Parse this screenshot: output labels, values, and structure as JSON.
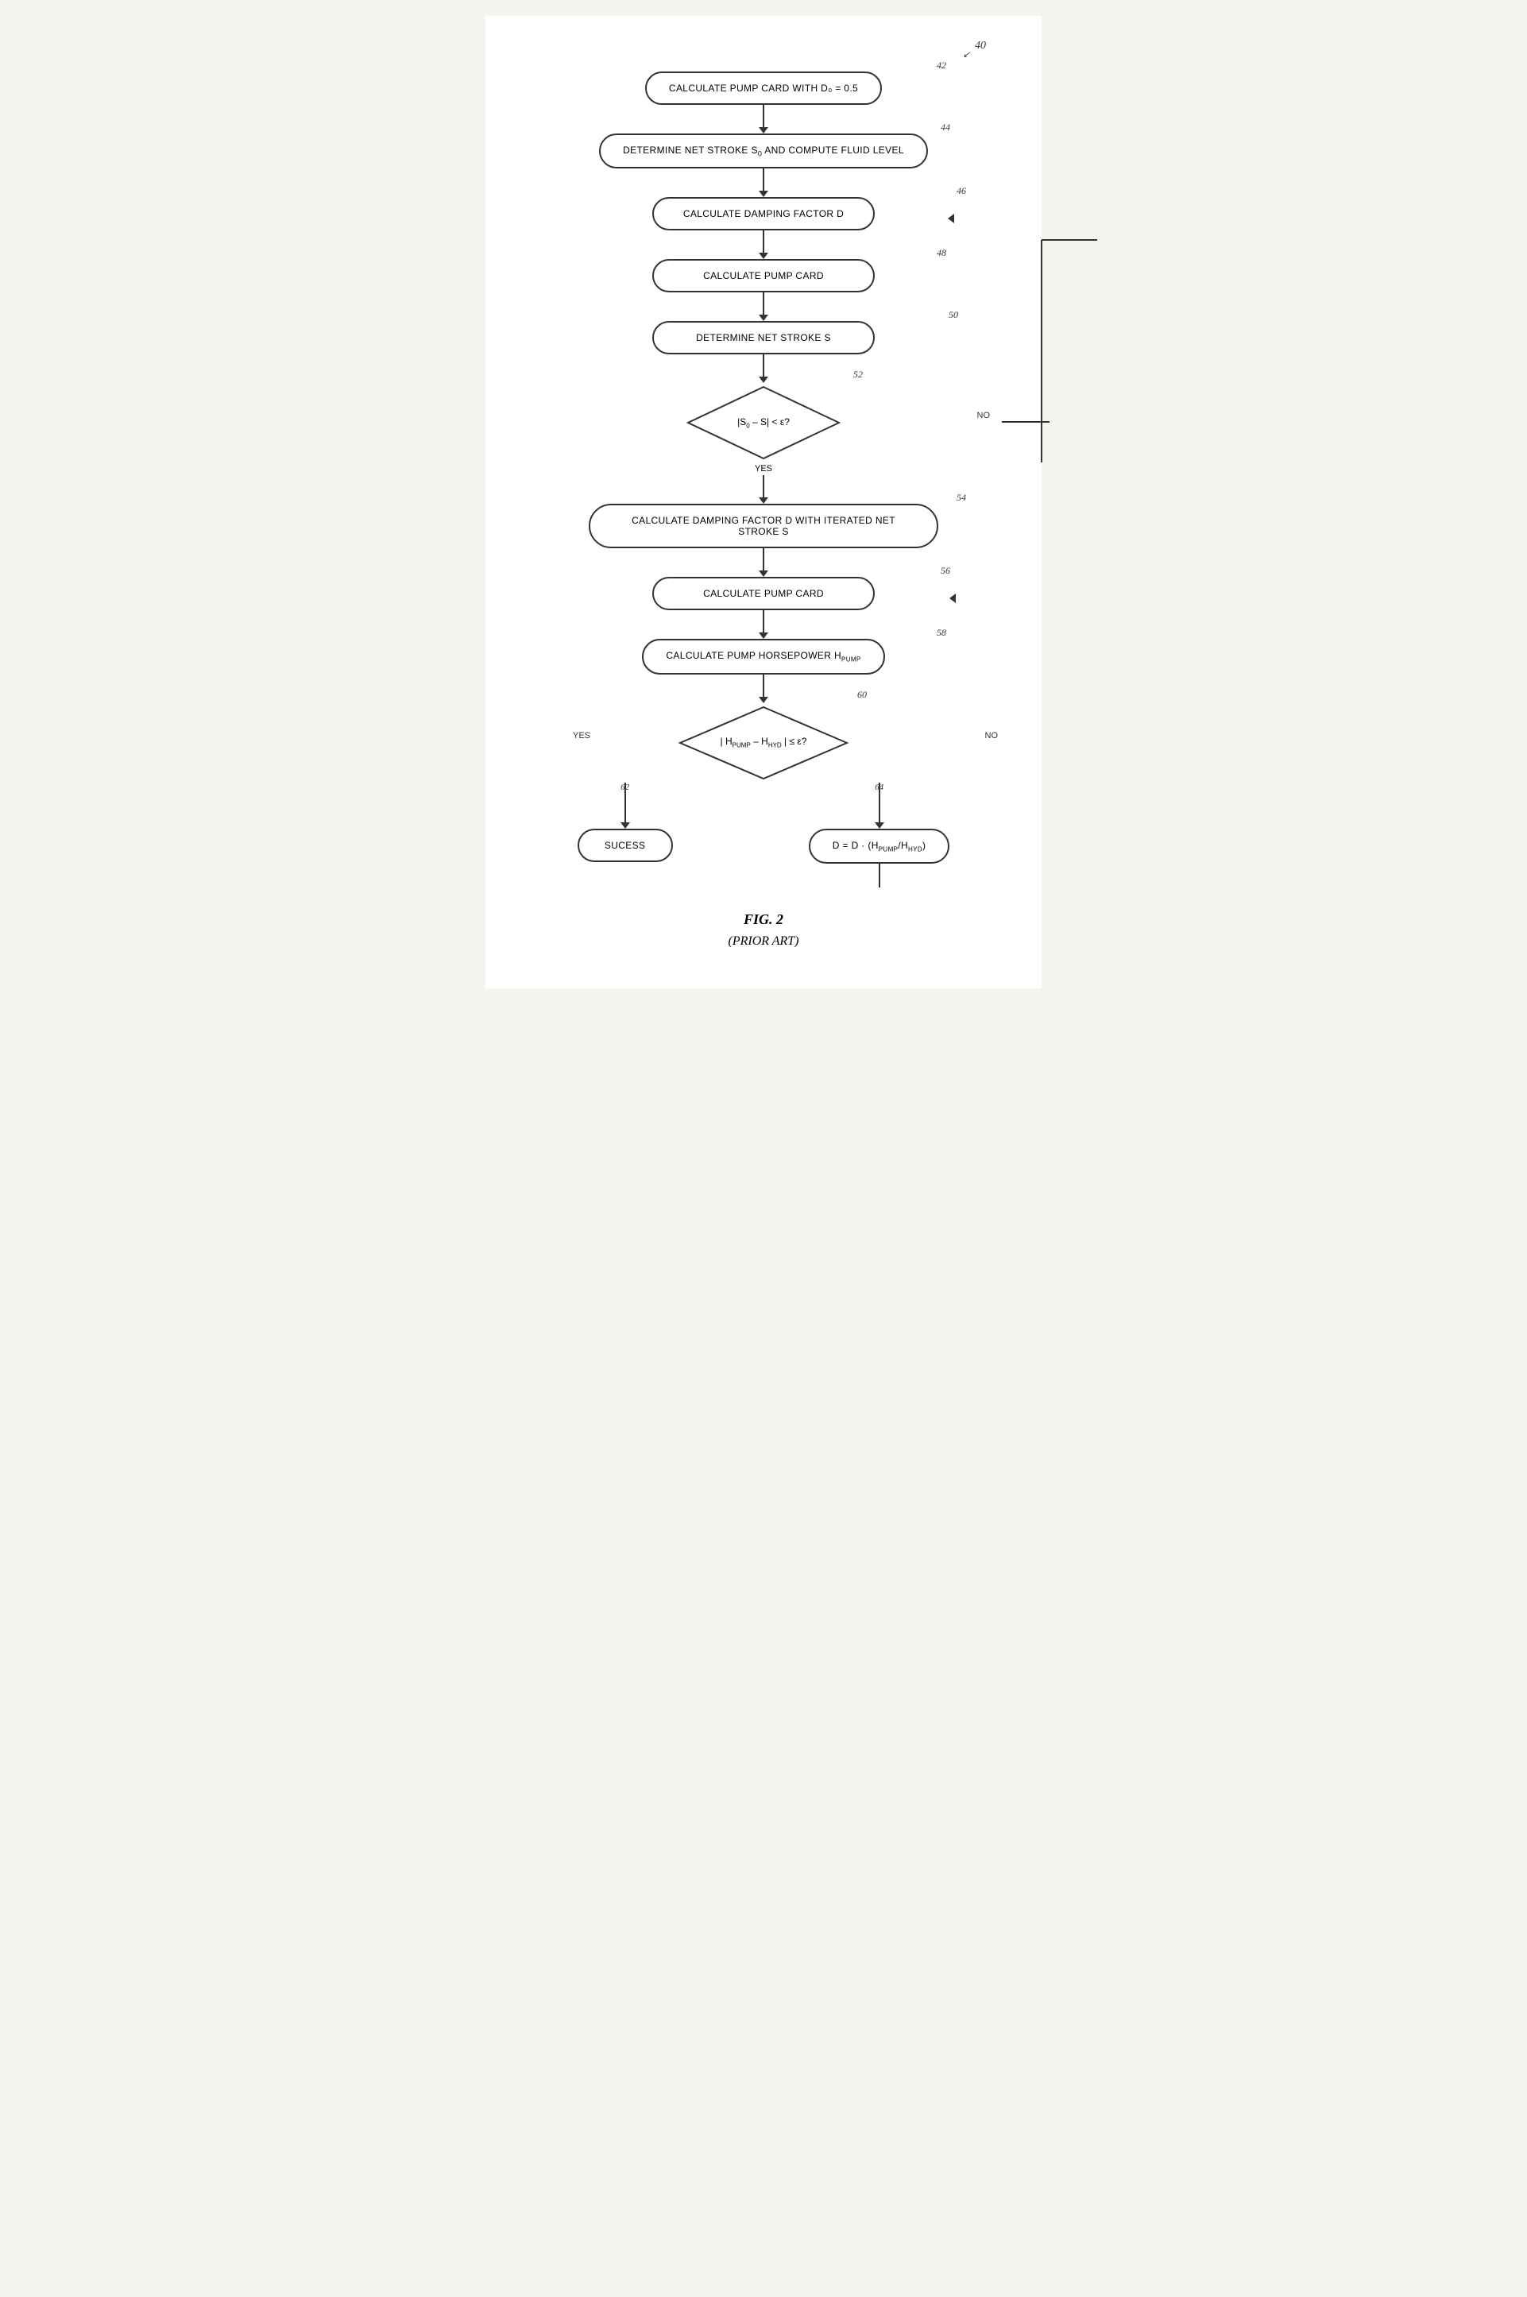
{
  "page": {
    "background": "white"
  },
  "nodes": {
    "n40_label": "40",
    "n42_label": "42",
    "n44_label": "44",
    "n46_label": "46",
    "n48_label": "48",
    "n50_label": "50",
    "n52_label": "52",
    "n54_label": "54",
    "n56_label": "56",
    "n58_label": "58",
    "n60_label": "60",
    "n62_label": "62",
    "n64_label": "64",
    "box1_text": "CALCULATE PUMP CARD WITH D₀ = 0.5",
    "box2_text": "DETERMINE NET STROKE S₀ AND COMPUTE FLUID LEVEL",
    "box3_text": "CALCULATE DAMPING FACTOR D",
    "box4_text": "CALCULATE PUMP CARD",
    "box5_text": "DETERMINE NET STROKE S",
    "diamond1_text": "|S₀ – S| < ε?",
    "box6_text": "CALCULATE DAMPING FACTOR D WITH ITERATED NET STROKE S",
    "box7_text": "CALCULATE PUMP CARD",
    "box8_text": "CALCULATE PUMP HORSEPOWER Hₚᵤᴹᴺ",
    "diamond2_text": "| Hₚᵤᴹᴺ – Hₕʏᴅ | ≤ ε?",
    "box9_text": "SUCESS",
    "box10_text": "D = D · (Hₚᵤᴹᴺ/Hₕʏᴅ)",
    "yes_label": "YES",
    "no_label": "NO",
    "yes2_label": "YES",
    "no2_label": "NO",
    "fig_label": "FIG. 2",
    "prior_art_label": "(PRIOR ART)"
  }
}
